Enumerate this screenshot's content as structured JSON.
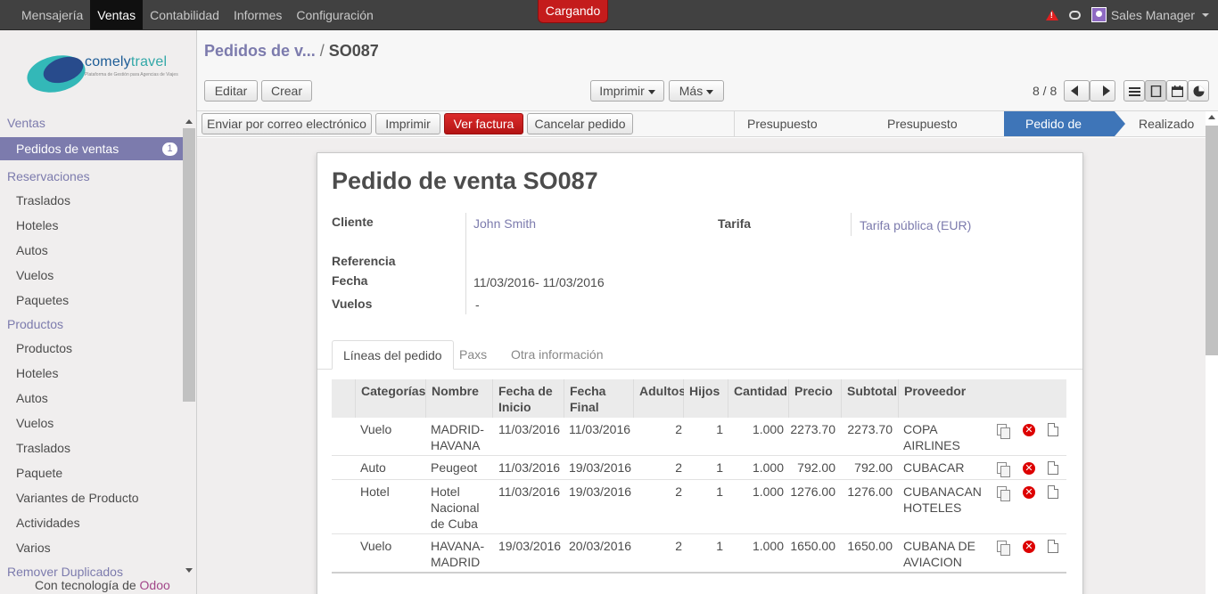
{
  "topbar": {
    "menu": [
      "Mensajería",
      "Ventas",
      "Contabilidad",
      "Informes",
      "Configuración"
    ],
    "active_menu": "Ventas",
    "loading": "Cargando",
    "user": "Sales Manager",
    "icons": [
      "warning-icon",
      "chat-icon",
      "avatar"
    ]
  },
  "sidebar": {
    "logo": {
      "name_a": "comely",
      "name_b": "travel",
      "tagline": "Plataforma de Gestión para Agencias de Viajes"
    },
    "sections": [
      {
        "header": "Ventas",
        "items": [
          "Pedidos de ventas"
        ]
      },
      {
        "header": "Reservaciones",
        "items": [
          "Traslados",
          "Hoteles",
          "Autos",
          "Vuelos",
          "Paquetes"
        ]
      },
      {
        "header": "Productos",
        "items": [
          "Productos",
          "Hoteles",
          "Autos",
          "Vuelos",
          "Traslados",
          "Paquete",
          "Variantes de Producto",
          "Actividades",
          "Varios"
        ]
      },
      {
        "header": "Remover Duplicados",
        "items": []
      }
    ],
    "selected_badge": "1",
    "powered_prefix": "Con tecnología de",
    "powered_brand": "Odoo"
  },
  "control_panel": {
    "breadcrumb_parent": "Pedidos de v...",
    "breadcrumb_sep": "/",
    "breadcrumb_current": "SO087",
    "edit": "Editar",
    "create": "Crear",
    "print": "Imprimir",
    "more": "Más",
    "pager": "8 / 8"
  },
  "statusbar": {
    "buttons": [
      "Enviar por correo electrónico",
      "Imprimir",
      "Ver factura",
      "Cancelar pedido"
    ],
    "stages": [
      "Presupuesto borrador",
      "Presupuesto enviado",
      "Pedido de venta",
      "Realizado"
    ],
    "active_stage": "Pedido de venta"
  },
  "form": {
    "title_prefix": "Pedido de venta",
    "title_number": "SO087",
    "labels": {
      "cliente": "Cliente",
      "tarifa": "Tarifa",
      "referencia": "Referencia",
      "fecha": "Fecha",
      "vuelos": "Vuelos"
    },
    "cliente": "John Smith",
    "tarifa": "Tarifa pública (EUR)",
    "fecha_desde": "11/03/2016",
    "fecha_sep": "-",
    "fecha_hasta": "11/03/2016",
    "vuelos": "-",
    "tabs": [
      "Líneas del pedido",
      "Paxs",
      "Otra información"
    ],
    "active_tab": "Líneas del pedido"
  },
  "lines": {
    "columns": [
      "Categorías",
      "Nombre",
      "Fecha de Inicio",
      "Fecha Final",
      "Adultos",
      "Hijos",
      "Cantidad",
      "Precio",
      "Subtotal",
      "Proveedor"
    ],
    "rows": [
      {
        "categoria": "Vuelo",
        "nombre": "MADRID-HAVANA",
        "inicio": "11/03/2016",
        "final": "11/03/2016",
        "adultos": "2",
        "hijos": "1",
        "cantidad": "1.000",
        "precio": "2273.70",
        "subtotal": "2273.70",
        "proveedor": "COPA AIRLINES"
      },
      {
        "categoria": "Auto",
        "nombre": "Peugeot",
        "inicio": "11/03/2016",
        "final": "19/03/2016",
        "adultos": "2",
        "hijos": "1",
        "cantidad": "1.000",
        "precio": "792.00",
        "subtotal": "792.00",
        "proveedor": "CUBACAR"
      },
      {
        "categoria": "Hotel",
        "nombre": "Hotel Nacional de Cuba",
        "inicio": "11/03/2016",
        "final": "19/03/2016",
        "adultos": "2",
        "hijos": "1",
        "cantidad": "1.000",
        "precio": "1276.00",
        "subtotal": "1276.00",
        "proveedor": "CUBANACAN HOTELES"
      },
      {
        "categoria": "Vuelo",
        "nombre": "HAVANA-MADRID",
        "inicio": "19/03/2016",
        "final": "20/03/2016",
        "adultos": "2",
        "hijos": "1",
        "cantidad": "1.000",
        "precio": "1650.00",
        "subtotal": "1650.00",
        "proveedor": "CUBANA DE AVIACION"
      }
    ]
  },
  "colors": {
    "brand": "#7c7bad",
    "active_stage": "#3e75b8",
    "invoice_button": "#c41c1c",
    "loading": "#c41c1c"
  }
}
